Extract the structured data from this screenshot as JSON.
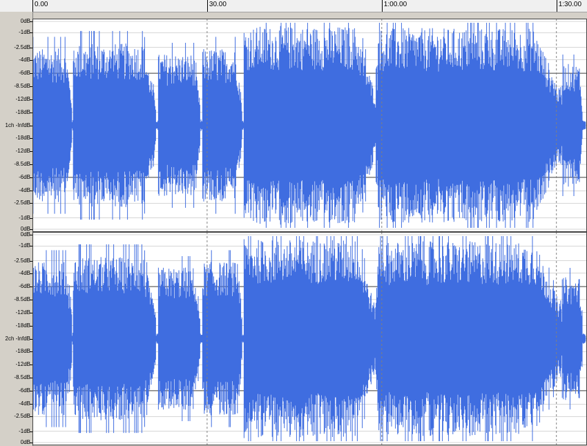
{
  "timeline": {
    "markers": [
      {
        "label": "0.00",
        "t": 0
      },
      {
        "label": "30.00",
        "t": 30
      },
      {
        "label": "1:00.00",
        "t": 60
      },
      {
        "label": "1:30.00",
        "t": 90
      }
    ],
    "duration_seconds": 95
  },
  "channels": [
    {
      "name": "channel-1",
      "scale_labels": [
        "0dB",
        "-1dB",
        "-2.5dB",
        "-4dB",
        "-6dB",
        "-8.5dB",
        "-12dB",
        "-18dB",
        "1ch -InfdB",
        "-18dB",
        "-12dB",
        "-8.5dB",
        "-6dB",
        "-4dB",
        "-2.5dB",
        "-1dB",
        "0dB"
      ]
    },
    {
      "name": "channel-2",
      "scale_labels": [
        "0dB",
        "-1dB",
        "-2.5dB",
        "-4dB",
        "-6dB",
        "-8.5dB",
        "-12dB",
        "-18dB",
        "2ch -InfdB",
        "-18dB",
        "-12dB",
        "-8.5dB",
        "-6dB",
        "-4dB",
        "-2.5dB",
        "-1dB",
        "0dB"
      ]
    }
  ],
  "colors": {
    "waveform": "#3f6de0",
    "background": "#ffffff",
    "grid": "#c8c8c8",
    "grid_dark": "#606060"
  }
}
